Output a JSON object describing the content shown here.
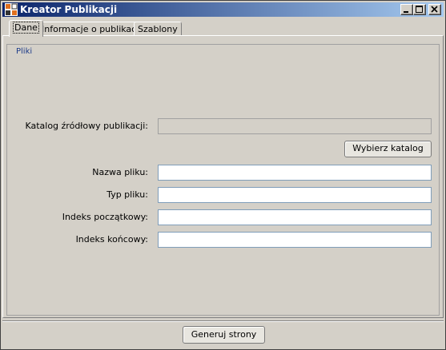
{
  "window": {
    "title": "Kreator Publikacji",
    "buttons": [
      "minimize",
      "maximize",
      "close"
    ]
  },
  "tabs": [
    {
      "label": "Dane",
      "active": true
    },
    {
      "label": "Informacje o publikacji",
      "active": false
    },
    {
      "label": "Szablony",
      "active": false
    }
  ],
  "group": {
    "legend": "Pliki"
  },
  "form": {
    "source_dir_label": "Katalog źródłowy publikacji:",
    "source_dir_value": "",
    "choose_dir_button": "Wybierz katalog",
    "file_name_label": "Nazwa pliku:",
    "file_name_value": "",
    "file_type_label": "Typ pliku:",
    "file_type_value": "",
    "start_index_label": "Indeks początkowy:",
    "start_index_value": "",
    "end_index_label": "Indeks końcowy:",
    "end_index_value": ""
  },
  "footer": {
    "generate_button": "Generuj strony"
  },
  "colors": {
    "titlebar_start": "#0a246a",
    "titlebar_end": "#a6caf0",
    "background": "#d4d0c8",
    "legend": "#1f3d8a"
  }
}
